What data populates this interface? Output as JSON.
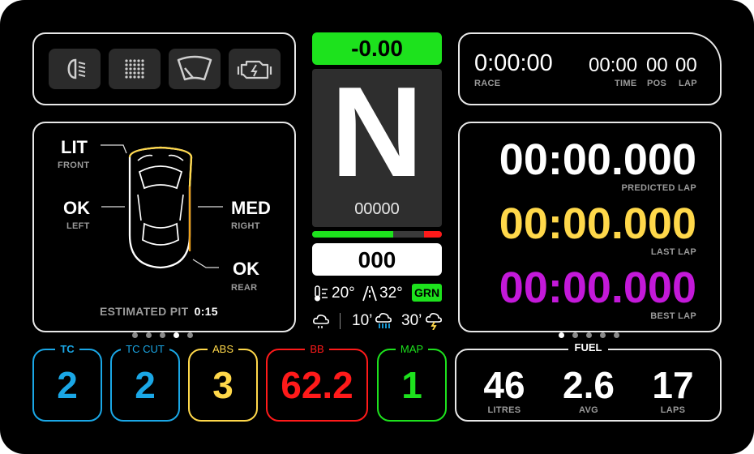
{
  "colors": {
    "green": "#1de21d",
    "red": "#ff1a1a",
    "yellow": "#ffd84a",
    "purple": "#c319d9",
    "cyan": "#1aa7e6",
    "orange": "#f0a21a"
  },
  "icons": [
    "headlight-icon",
    "dot-grid-icon",
    "wiper-icon",
    "engine-warning-icon"
  ],
  "delta": "-0.00",
  "gear": "N",
  "rpm": "00000",
  "speed": "000",
  "race": {
    "time": "0:00:00",
    "time_label": "RACE",
    "session_time": "00:00",
    "session_label": "TIME",
    "pos": "00",
    "pos_label": "POS",
    "lap": "00",
    "lap_label": "LAP"
  },
  "laps": {
    "predicted": "00:00.000",
    "predicted_label": "PREDICTED LAP",
    "last": "00:00.000",
    "last_label": "LAST LAP",
    "best": "00:00.000",
    "best_label": "BEST LAP"
  },
  "car": {
    "front": "LIT",
    "front_label": "FRONT",
    "left": "OK",
    "left_label": "LEFT",
    "right": "MED",
    "right_label": "RIGHT",
    "rear": "OK",
    "rear_label": "REAR",
    "pit_label": "ESTIMATED PIT",
    "pit_value": "0:15"
  },
  "weather": {
    "air": "20°",
    "track": "32°",
    "flag": "GRN",
    "rain_10": "10’",
    "rain_30": "30’"
  },
  "settings": [
    {
      "label": "TC",
      "value": "2"
    },
    {
      "label": "TC CUT",
      "value": "2"
    },
    {
      "label": "ABS",
      "value": "3"
    },
    {
      "label": "BB",
      "value": "62.2"
    },
    {
      "label": "MAP",
      "value": "1"
    }
  ],
  "fuel": {
    "title": "FUEL",
    "litres": "46",
    "litres_label": "LITRES",
    "avg": "2.6",
    "avg_label": "AVG",
    "laps": "17",
    "laps_label": "LAPS"
  }
}
